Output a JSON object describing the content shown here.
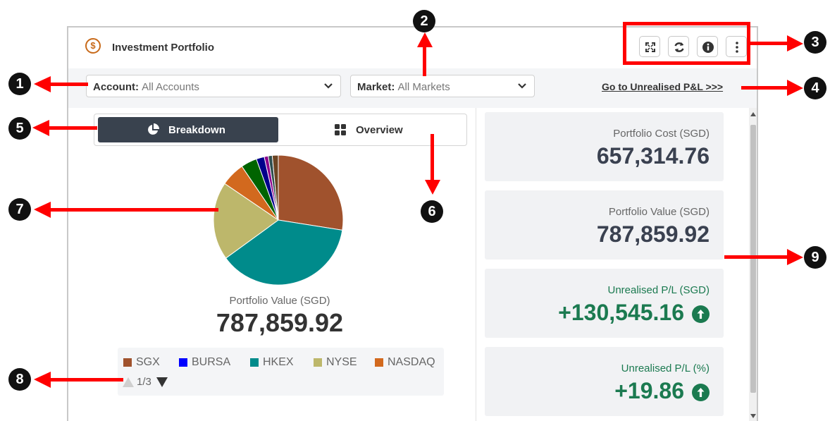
{
  "header": {
    "icon": "dollar-circle-icon",
    "title": "Investment Portfolio",
    "controls": [
      "expand-icon",
      "refresh-icon",
      "info-icon",
      "more-vertical-icon"
    ]
  },
  "filters": {
    "account": {
      "label": "Account:",
      "value": "All Accounts"
    },
    "market": {
      "label": "Market:",
      "value": "All Markets"
    },
    "pl_link": "Go to Unrealised P&L >>>"
  },
  "toggle": {
    "breakdown": "Breakdown",
    "overview": "Overview",
    "active": "breakdown"
  },
  "chart_data": {
    "type": "pie",
    "categories": [
      "SGX",
      "HKEX",
      "NYSE",
      "NASDAQ",
      "other-1",
      "other-2",
      "other-3",
      "other-4",
      "other-5"
    ],
    "values": [
      27.5,
      37.5,
      19.5,
      6,
      4,
      2,
      1,
      1,
      1.5
    ],
    "colors": [
      "#a0522d",
      "#008b8b",
      "#bdb76b",
      "#d2691e",
      "#006400",
      "#00008b",
      "#8b008b",
      "#2f4f4f",
      "#6b4423"
    ]
  },
  "portfolio_summary": {
    "label": "Portfolio Value (SGD)",
    "value": "787,859.92"
  },
  "legend": {
    "items": [
      {
        "name": "SGX",
        "color": "#a0522d"
      },
      {
        "name": "BURSA",
        "color": "#0000ff"
      },
      {
        "name": "HKEX",
        "color": "#008b8b"
      },
      {
        "name": "NYSE",
        "color": "#bdb76b"
      },
      {
        "name": "NASDAQ",
        "color": "#d2691e"
      }
    ],
    "page": "1/3"
  },
  "cards": [
    {
      "label": "Portfolio Cost (SGD)",
      "value": "657,314.76"
    },
    {
      "label": "Portfolio Value (SGD)",
      "value": "787,859.92"
    },
    {
      "label": "Unrealised P/L (SGD)",
      "value": "+130,545.16",
      "trend": "arrow-up-circle-icon"
    },
    {
      "label": "Unrealised P/L (%)",
      "value": "+19.86",
      "trend": "arrow-up-circle-icon"
    }
  ],
  "callouts": [
    "1",
    "2",
    "3",
    "4",
    "5",
    "6",
    "7",
    "8",
    "9"
  ],
  "colors": {
    "accent_dark": "#39424e",
    "positive": "#1b7a50",
    "callout_red": "#ff0000"
  }
}
